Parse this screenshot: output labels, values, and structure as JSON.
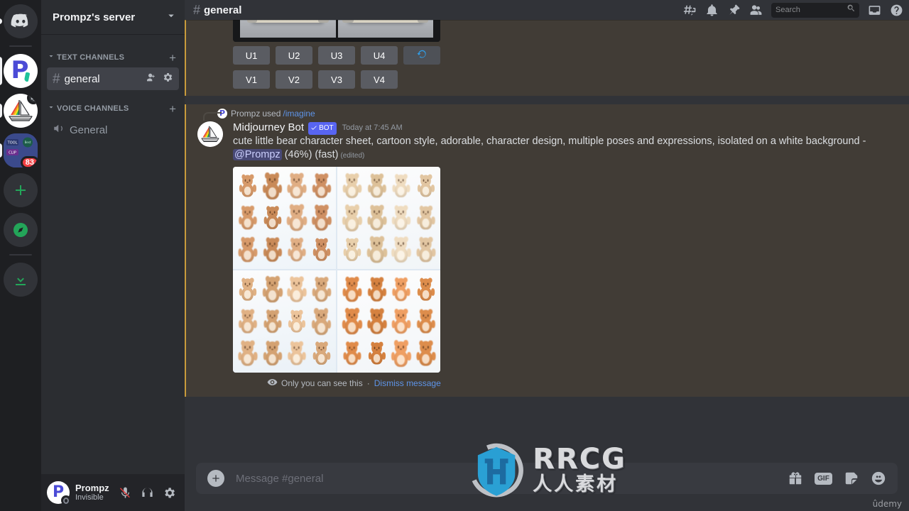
{
  "server_rail": {
    "items": [
      {
        "name": "home",
        "icon": "discord-home-icon",
        "label": "",
        "badge": "",
        "pill": "sm"
      },
      {
        "name": "prompz",
        "icon": "prompz-logo-icon",
        "label": "P",
        "badge": "",
        "pill": "lg"
      },
      {
        "name": "midjourney",
        "icon": "midjourney-sailboat-icon",
        "label": "",
        "badge": "",
        "pill": "md"
      },
      {
        "name": "other-server",
        "icon": "server-thumbnail-icon",
        "label": "",
        "badge": "83",
        "pill": "md"
      }
    ],
    "add_server_label": "+",
    "explore_label": "Explore Public Servers",
    "download_label": "Download Apps"
  },
  "sidebar": {
    "guild_name": "Prompz's server",
    "categories": [
      {
        "label": "TEXT CHANNELS",
        "add_label": "+",
        "channels": [
          {
            "name": "general",
            "prefix": "#",
            "active": true,
            "actions": [
              "create-invite-icon",
              "edit-channel-icon"
            ]
          }
        ]
      },
      {
        "label": "VOICE CHANNELS",
        "add_label": "+",
        "channels": [
          {
            "name": "General",
            "prefix": "volume",
            "active": false,
            "actions": []
          }
        ]
      }
    ]
  },
  "user_panel": {
    "username": "Prompz",
    "status": "Invisible",
    "buttons": [
      {
        "name": "microphone-muted-button",
        "icon": "mic-muted-icon"
      },
      {
        "name": "headphones-button",
        "icon": "headphones-icon"
      },
      {
        "name": "user-settings-button",
        "icon": "gear-icon"
      }
    ]
  },
  "topbar": {
    "channel_prefix": "#",
    "channel_name": "general",
    "icons": [
      {
        "name": "threads-icon"
      },
      {
        "name": "notification-bell-icon"
      },
      {
        "name": "pinned-messages-icon"
      },
      {
        "name": "member-list-icon"
      }
    ],
    "search": {
      "placeholder": "Search"
    },
    "right_icons": [
      {
        "name": "inbox-icon"
      },
      {
        "name": "help-icon"
      }
    ]
  },
  "messages": [
    {
      "id": "msg-upscale",
      "type": "midjourney-result",
      "image": {
        "alt": "two white tufted sofas with gold wall ornaments",
        "kind": "sofa"
      },
      "buttons": {
        "row1": [
          "U1",
          "U2",
          "U3",
          "U4"
        ],
        "row2": [
          "V1",
          "V2",
          "V3",
          "V4"
        ],
        "refresh_icon": "refresh-icon"
      }
    },
    {
      "id": "msg-imagine",
      "type": "midjourney-job",
      "command_line": {
        "user": "Prompz",
        "used_text": "used",
        "command": "/imagine"
      },
      "author": "Midjourney Bot",
      "bot_tag": "BOT",
      "timestamp": "Today at 7:45 AM",
      "text_before_mention": "cute little bear character sheet, cartoon style, adorable, character design, multiple poses and expressions, isolated on a white background - ",
      "mention": "@Prompz",
      "text_after_mention": " (46%) (fast)",
      "edited_label": "(edited)",
      "image": {
        "alt": "grid of cute cartoon teddy bear character sheets",
        "kind": "bear-sheet"
      },
      "ephemeral": {
        "icon": "eye-icon",
        "text": "Only you can see this",
        "separator": "·",
        "dismiss_label": "Dismiss message"
      }
    }
  ],
  "composer": {
    "add_icon": "plus-icon",
    "placeholder": "Message #general",
    "right_icons": [
      {
        "name": "gift-icon",
        "label": ""
      },
      {
        "name": "gif-icon",
        "label": "GIF"
      },
      {
        "name": "sticker-icon",
        "label": ""
      },
      {
        "name": "emoji-icon",
        "label": ""
      }
    ]
  },
  "watermark": {
    "brand": "RRCG",
    "subtitle": "人人素材",
    "corner": "ûdemy"
  },
  "colors": {
    "accent_blurple": "#5865f2",
    "mj_highlight_bar": "#c79a3c",
    "mj_message_bg": "#413c36",
    "app_bg": "#313338",
    "sidebar_bg": "#2b2d31",
    "rail_bg": "#1e1f22",
    "link_blue": "#5e94e8",
    "badge_red": "#f23f43",
    "online_green": "#23a559"
  }
}
